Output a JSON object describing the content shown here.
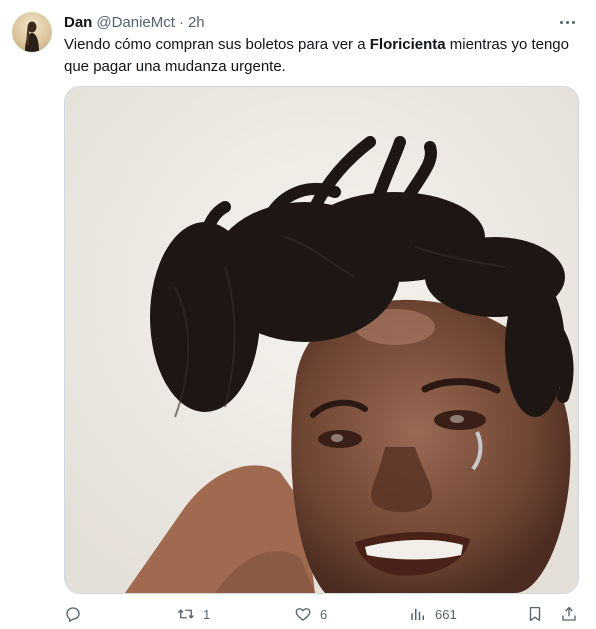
{
  "author": {
    "name": "Dan",
    "handle": "@DanieMct",
    "separator": "·",
    "time": "2h"
  },
  "tweet": {
    "text_part1": "Viendo cómo compran sus boletos para ver a ",
    "text_bold": "Floricienta",
    "text_part2": " mientras yo tengo que pagar una mudanza urgente."
  },
  "icons": {
    "more": "more-horizontal-icon",
    "reply": "reply-icon",
    "retweet": "retweet-icon",
    "like": "heart-icon",
    "views": "views-chart-icon",
    "bookmark": "bookmark-icon",
    "share": "share-icon"
  },
  "actions": {
    "reply_count": "",
    "retweet_count": "1",
    "like_count": "6",
    "views_count": "661"
  },
  "colors": {
    "text_primary": "#0f1419",
    "text_secondary": "#536471",
    "media_border": "#cfd9de"
  }
}
